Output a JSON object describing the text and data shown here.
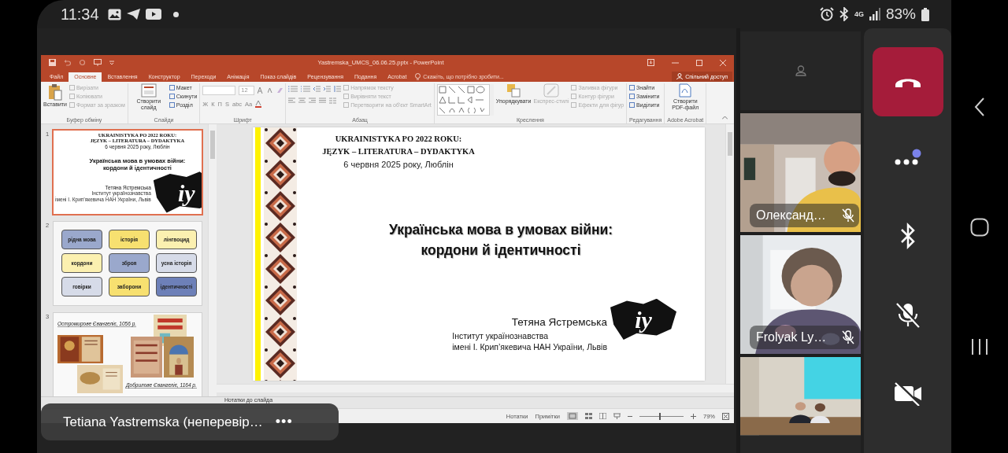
{
  "status_bar": {
    "time": "11:34",
    "network": "4G",
    "battery": "83%"
  },
  "powerpoint": {
    "title": "Yastremska_UMCS_06.06.25.pptx - PowerPoint",
    "tabs": [
      {
        "label": "Файл",
        "selected": false
      },
      {
        "label": "Основне",
        "selected": true
      },
      {
        "label": "Вставлення",
        "selected": false
      },
      {
        "label": "Конструктор",
        "selected": false
      },
      {
        "label": "Переходи",
        "selected": false
      },
      {
        "label": "Анімація",
        "selected": false
      },
      {
        "label": "Показ слайдів",
        "selected": false
      },
      {
        "label": "Рецензування",
        "selected": false
      },
      {
        "label": "Подання",
        "selected": false
      },
      {
        "label": "Acrobat",
        "selected": false
      }
    ],
    "tell_me": "Скажіть, що потрібно зробити...",
    "share": "Спільний доступ",
    "ribbon": [
      {
        "kind": "clipboard",
        "label": "Буфер обміну",
        "large": [
          {
            "kind": "paste",
            "label": "Вставити",
            "disabled": false
          }
        ],
        "small": [
          {
            "label": "Вирізати",
            "disabled": true
          },
          {
            "label": "Копіювати",
            "disabled": true
          },
          {
            "label": "Формат за зразком",
            "disabled": true
          }
        ]
      },
      {
        "kind": "slides",
        "label": "Слайди",
        "large": [
          {
            "kind": "new-slide",
            "label": "Створити слайд",
            "disabled": false
          }
        ],
        "small": [
          {
            "label": "Макет",
            "disabled": false
          },
          {
            "label": "Скинути",
            "disabled": false
          },
          {
            "label": "Розділ",
            "disabled": false
          }
        ]
      },
      {
        "kind": "font",
        "label": "Шрифт",
        "size": "12",
        "format": [
          "Ж",
          "К",
          "П",
          "S",
          "abc",
          "Aa"
        ]
      },
      {
        "kind": "paragraph",
        "label": "Абзац",
        "small": [
          {
            "label": "Напрямок тексту",
            "disabled": true
          },
          {
            "label": "Вирівняти текст",
            "disabled": true
          },
          {
            "label": "Перетворити на об'єкт SmartArt",
            "disabled": true
          }
        ]
      },
      {
        "kind": "drawing",
        "label": "Креслення",
        "large": [
          {
            "kind": "arrange",
            "label": "Упорядкувати",
            "disabled": false
          },
          {
            "kind": "styles",
            "label": "Експрес-стилі",
            "disabled": true
          }
        ],
        "small": [
          {
            "label": "Заливка фігури",
            "disabled": true
          },
          {
            "label": "Контур фігури",
            "disabled": true
          },
          {
            "label": "Ефекти для фігур",
            "disabled": true
          }
        ]
      },
      {
        "kind": "editing",
        "label": "Редагування",
        "small": [
          {
            "label": "Знайти",
            "disabled": false
          },
          {
            "label": "Замінити",
            "disabled": false
          },
          {
            "label": "Виділити",
            "disabled": false
          }
        ]
      },
      {
        "kind": "acrobat",
        "label": "Adobe Acrobat",
        "large": [
          {
            "kind": "pdf",
            "label": "Створити PDF-файл",
            "disabled": false
          }
        ]
      }
    ],
    "thumbnails": [
      {
        "number": "1",
        "selected": true,
        "kind": "title",
        "header": [
          "UKRAINISTYKA PO 2022 ROKU:",
          "JĘZYK – LITERATURA – DYDAKTYKA"
        ],
        "date": "6 червня 2025 року, Люблін",
        "title": [
          "Українська мова в умовах війни:",
          "кордони й ідентичності"
        ],
        "author": "Тетяна Ястремська",
        "affiliation": [
          "Інститут українознавства",
          "імені І. Крип’якевича НАН України, Львів"
        ],
        "logo": "iy"
      },
      {
        "number": "2",
        "selected": false,
        "kind": "tiles",
        "tiles": [
          {
            "text": "рідна мова",
            "color": "#9aa8cc"
          },
          {
            "text": "історія",
            "color": "#f7e070"
          },
          {
            "text": "лінгвоцид",
            "color": "#fbf0b0"
          },
          {
            "text": "кордони",
            "color": "#fbf0b0"
          },
          {
            "text": "зброя",
            "color": "#9aa8cc"
          },
          {
            "text": "усна історія",
            "color": "#d6dbe8"
          },
          {
            "text": "говірки",
            "color": "#d6dbe8"
          },
          {
            "text": "заборони",
            "color": "#f7e070"
          },
          {
            "text": "ідентичності",
            "color": "#6d80b8"
          }
        ]
      },
      {
        "number": "3",
        "selected": false,
        "kind": "manuscripts",
        "captions": [
          "Остромирове Євангеліє, 1056 р.",
          "Добрилове Євангеліє, 1164 р."
        ]
      }
    ],
    "slide": {
      "header": [
        "UKRAINISTYKA PO 2022 ROKU:",
        "JĘZYK – LITERATURA – DYDAKTYKA"
      ],
      "date": "6 червня 2025 року, Люблін",
      "title": [
        "Українська мова в умовах війни:",
        "кордони й ідентичності"
      ],
      "author": "Тетяна Ястремська",
      "affiliation": [
        "Інститут українознавства",
        "імені І. Крип’якевича НАН України, Львів"
      ],
      "logo": "iy"
    },
    "notes": "Нотатки до слайда",
    "status": {
      "notes": "Нотатки",
      "comments": "Примітки",
      "zoom": {
        "level": 0.45,
        "reading": "79%"
      }
    }
  },
  "presenter": {
    "name": "Tetiana Yastremska (неперевір…",
    "menu": "•••"
  },
  "participants": [
    {
      "kind": "avatar"
    },
    {
      "kind": "video",
      "name": "Олександ…",
      "muted": true
    },
    {
      "kind": "video",
      "name": "Frolyak Ly…",
      "muted": true
    },
    {
      "kind": "video"
    }
  ],
  "controls": [
    {
      "kind": "hangup"
    },
    {
      "kind": "more",
      "badge": true
    },
    {
      "kind": "bluetooth"
    },
    {
      "kind": "mic",
      "muted": true
    },
    {
      "kind": "camera",
      "off": true
    }
  ]
}
